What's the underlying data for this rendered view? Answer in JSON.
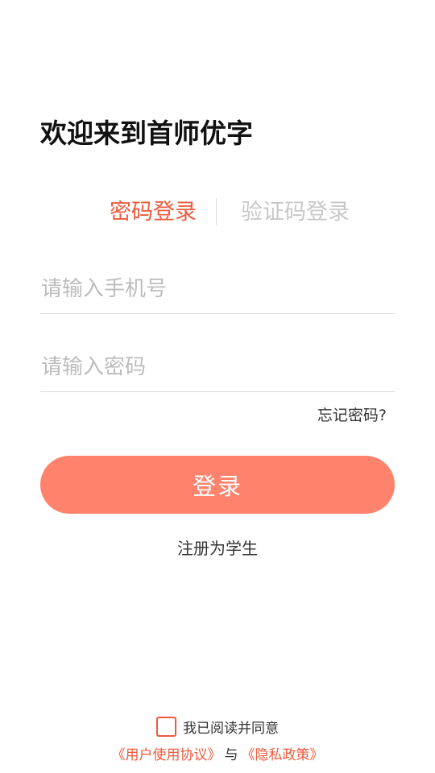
{
  "welcome_title": "欢迎来到首师优字",
  "tabs": [
    {
      "label": "密码登录",
      "active": true
    },
    {
      "label": "验证码登录",
      "active": false
    }
  ],
  "form": {
    "phone": {
      "value": "",
      "placeholder": "请输入手机号"
    },
    "password": {
      "value": "",
      "placeholder": "请输入密码"
    }
  },
  "forgot_password": "忘记密码?",
  "login_button": "登录",
  "register_link": "注册为学生",
  "agreement": {
    "checked": false,
    "text": "我已阅读并同意",
    "user_agreement": "《用户使用协议》",
    "separator": "与",
    "privacy_policy": "《隐私政策》"
  },
  "colors": {
    "accent": "#ef5a3e",
    "button": "#ff836c",
    "inactive_tab": "#c8c8c8"
  }
}
